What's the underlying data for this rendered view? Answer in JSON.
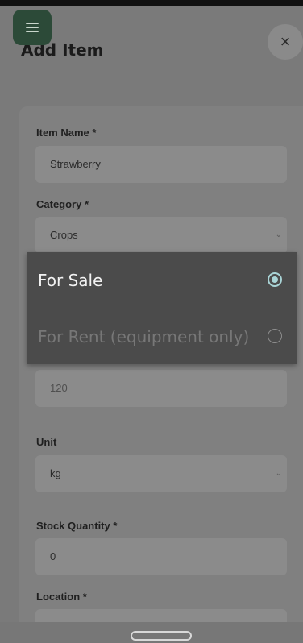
{
  "header": {
    "title": "Add Item",
    "close_symbol": "×",
    "menu_icon": "menu-icon",
    "close_icon": "close-icon"
  },
  "form": {
    "item_name": {
      "label": "Item Name *",
      "value": "Strawberry"
    },
    "category": {
      "label": "Category *",
      "value": "Crops"
    },
    "price": {
      "value": "120"
    },
    "unit": {
      "label": "Unit",
      "value": "kg"
    },
    "stock": {
      "label": "Stock Quantity *",
      "value": "0"
    },
    "location": {
      "label": "Location *"
    }
  },
  "listing_type_dialog": {
    "options": [
      {
        "label": "For Sale",
        "selected": true
      },
      {
        "label": "For Rent (equipment only)",
        "selected": false
      }
    ]
  },
  "colors": {
    "accent": "#a9d4d6",
    "menu_button": "#2c4a38"
  }
}
